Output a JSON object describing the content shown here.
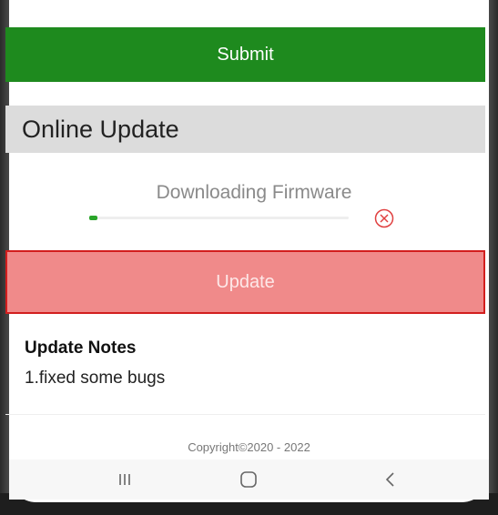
{
  "submit": {
    "label": "Submit"
  },
  "online_update": {
    "title": "Online Update",
    "status_text": "Downloading Firmware",
    "progress": 0.02,
    "cancel_icon": "close-circle-icon",
    "update_label": "Update"
  },
  "notes": {
    "title": "Update Notes",
    "body": "1.fixed some bugs"
  },
  "footer": {
    "copyright": "Copyright©2020 - 2022"
  },
  "navbar": {
    "recents_icon": "recents-icon",
    "home_icon": "home-icon",
    "back_icon": "back-icon"
  },
  "colors": {
    "submit_bg": "#1e8a1e",
    "update_bg": "#f08a8a",
    "update_border": "#d21e1e",
    "progress_fill": "#2aa52a",
    "cancel_icon": "#e04040"
  }
}
